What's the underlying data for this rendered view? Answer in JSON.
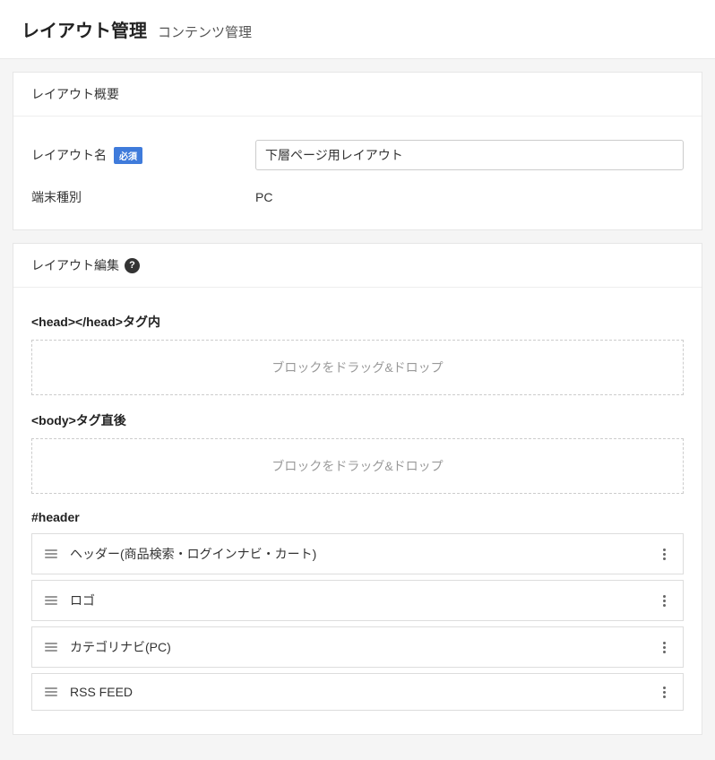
{
  "header": {
    "title": "レイアウト管理",
    "subtitle": "コンテンツ管理"
  },
  "overview": {
    "heading": "レイアウト概要",
    "name_label": "レイアウト名",
    "required_badge": "必須",
    "name_value": "下層ページ用レイアウト",
    "device_label": "端末種別",
    "device_value": "PC"
  },
  "edit": {
    "heading": "レイアウト編集",
    "help_symbol": "?",
    "head_zone_label": "<head></head>タグ内",
    "body_zone_label": "<body>タグ直後",
    "dropzone_placeholder": "ブロックをドラッグ&ドロップ",
    "header_zone_label": "#header",
    "header_blocks": [
      "ヘッダー(商品検索・ログインナビ・カート)",
      "ロゴ",
      "カテゴリナビ(PC)",
      "RSS FEED"
    ]
  }
}
